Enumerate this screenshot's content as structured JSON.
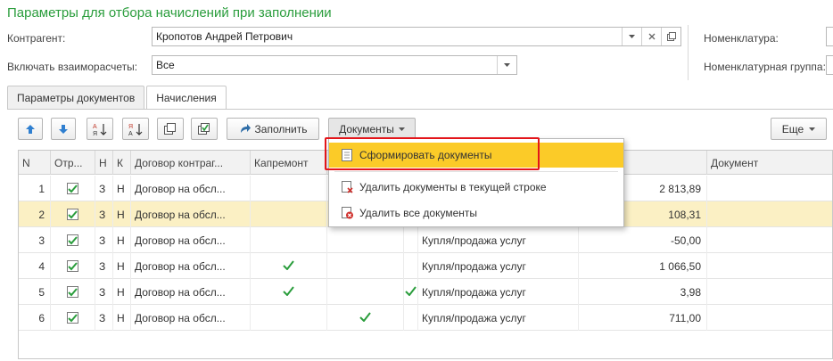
{
  "title": "Параметры для отбора начислений при заполнении",
  "form": {
    "contragent_label": "Контрагент:",
    "contragent_value": "Кропотов Андрей Петрович",
    "vzaimo_label": "Включать взаиморасчеты:",
    "vzaimo_value": "Все",
    "nomenklatura_label": "Номенклатура:",
    "nomgroup_label": "Номенклатурная группа:"
  },
  "tabs": [
    {
      "label": "Параметры документов",
      "active": false
    },
    {
      "label": "Начисления",
      "active": true
    }
  ],
  "toolbar": {
    "fill_label": "Заполнить",
    "documents_label": "Документы",
    "more_label": "Еще"
  },
  "icons": {
    "up": "arrow-up-icon",
    "down": "arrow-down-icon",
    "sort_asc": "sort-ascending-icon",
    "sort_desc": "sort-descending-icon",
    "copy": "copy-icon",
    "check_all": "check-all-icon",
    "fill": "fill-arrow-icon"
  },
  "colors": {
    "title_green": "#2a9d3c",
    "highlight": "#fbcb28",
    "selected_row": "#fbf0c4",
    "red_frame": "#e3151a"
  },
  "grid": {
    "columns": [
      {
        "label": "N"
      },
      {
        "label": "Отр..."
      },
      {
        "label": "Н"
      },
      {
        "label": "К"
      },
      {
        "label": "Договор контраг..."
      },
      {
        "label": "Капремонт"
      },
      {
        "label": ""
      },
      {
        "label": ""
      },
      {
        "label": ""
      },
      {
        "label": "ислений"
      },
      {
        "label": "Документ"
      }
    ],
    "rows": [
      {
        "n": "1",
        "c2": "З",
        "c3": "Н",
        "dog": "Договор на обсл...",
        "kap": false,
        "c6": false,
        "c7": false,
        "vid": "",
        "sum": "2 813,89"
      },
      {
        "n": "2",
        "c2": "З",
        "c3": "Н",
        "dog": "Договор на обсл...",
        "kap": false,
        "c6": false,
        "c7": false,
        "vid": "",
        "sum": "108,31",
        "selected": true
      },
      {
        "n": "3",
        "c2": "З",
        "c3": "Н",
        "dog": "Договор на обсл...",
        "kap": false,
        "c6": false,
        "c7": false,
        "vid": "Купля/продажа услуг",
        "sum": "-50,00"
      },
      {
        "n": "4",
        "c2": "З",
        "c3": "Н",
        "dog": "Договор на обсл...",
        "kap": true,
        "c6": false,
        "c7": false,
        "vid": "Купля/продажа услуг",
        "sum": "1 066,50"
      },
      {
        "n": "5",
        "c2": "З",
        "c3": "Н",
        "dog": "Договор на обсл...",
        "kap": true,
        "c6": false,
        "c7": true,
        "vid": "Купля/продажа услуг",
        "sum": "3,98"
      },
      {
        "n": "6",
        "c2": "З",
        "c3": "Н",
        "dog": "Договор на обсл...",
        "kap": false,
        "c6": true,
        "c7": false,
        "vid": "Купля/продажа услуг",
        "sum": "711,00"
      }
    ]
  },
  "menu": {
    "items": [
      {
        "label": "Сформировать документы",
        "icon": "document-icon",
        "highlighted": true
      },
      {
        "label": "Удалить документы в текущей строке",
        "icon": "delete-document-icon",
        "highlighted": false
      },
      {
        "label": "Удалить все документы",
        "icon": "delete-all-documents-icon",
        "highlighted": false
      }
    ]
  }
}
